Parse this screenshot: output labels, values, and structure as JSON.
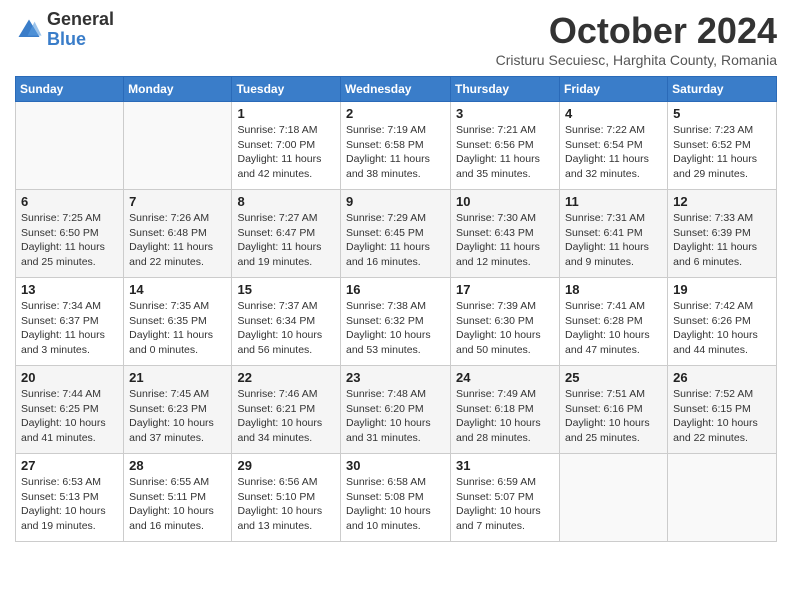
{
  "header": {
    "logo_general": "General",
    "logo_blue": "Blue",
    "month_title": "October 2024",
    "subtitle": "Cristuru Secuiesc, Harghita County, Romania"
  },
  "days_of_week": [
    "Sunday",
    "Monday",
    "Tuesday",
    "Wednesday",
    "Thursday",
    "Friday",
    "Saturday"
  ],
  "weeks": [
    [
      {
        "day": "",
        "info": ""
      },
      {
        "day": "",
        "info": ""
      },
      {
        "day": "1",
        "info": "Sunrise: 7:18 AM\nSunset: 7:00 PM\nDaylight: 11 hours and 42 minutes."
      },
      {
        "day": "2",
        "info": "Sunrise: 7:19 AM\nSunset: 6:58 PM\nDaylight: 11 hours and 38 minutes."
      },
      {
        "day": "3",
        "info": "Sunrise: 7:21 AM\nSunset: 6:56 PM\nDaylight: 11 hours and 35 minutes."
      },
      {
        "day": "4",
        "info": "Sunrise: 7:22 AM\nSunset: 6:54 PM\nDaylight: 11 hours and 32 minutes."
      },
      {
        "day": "5",
        "info": "Sunrise: 7:23 AM\nSunset: 6:52 PM\nDaylight: 11 hours and 29 minutes."
      }
    ],
    [
      {
        "day": "6",
        "info": "Sunrise: 7:25 AM\nSunset: 6:50 PM\nDaylight: 11 hours and 25 minutes."
      },
      {
        "day": "7",
        "info": "Sunrise: 7:26 AM\nSunset: 6:48 PM\nDaylight: 11 hours and 22 minutes."
      },
      {
        "day": "8",
        "info": "Sunrise: 7:27 AM\nSunset: 6:47 PM\nDaylight: 11 hours and 19 minutes."
      },
      {
        "day": "9",
        "info": "Sunrise: 7:29 AM\nSunset: 6:45 PM\nDaylight: 11 hours and 16 minutes."
      },
      {
        "day": "10",
        "info": "Sunrise: 7:30 AM\nSunset: 6:43 PM\nDaylight: 11 hours and 12 minutes."
      },
      {
        "day": "11",
        "info": "Sunrise: 7:31 AM\nSunset: 6:41 PM\nDaylight: 11 hours and 9 minutes."
      },
      {
        "day": "12",
        "info": "Sunrise: 7:33 AM\nSunset: 6:39 PM\nDaylight: 11 hours and 6 minutes."
      }
    ],
    [
      {
        "day": "13",
        "info": "Sunrise: 7:34 AM\nSunset: 6:37 PM\nDaylight: 11 hours and 3 minutes."
      },
      {
        "day": "14",
        "info": "Sunrise: 7:35 AM\nSunset: 6:35 PM\nDaylight: 11 hours and 0 minutes."
      },
      {
        "day": "15",
        "info": "Sunrise: 7:37 AM\nSunset: 6:34 PM\nDaylight: 10 hours and 56 minutes."
      },
      {
        "day": "16",
        "info": "Sunrise: 7:38 AM\nSunset: 6:32 PM\nDaylight: 10 hours and 53 minutes."
      },
      {
        "day": "17",
        "info": "Sunrise: 7:39 AM\nSunset: 6:30 PM\nDaylight: 10 hours and 50 minutes."
      },
      {
        "day": "18",
        "info": "Sunrise: 7:41 AM\nSunset: 6:28 PM\nDaylight: 10 hours and 47 minutes."
      },
      {
        "day": "19",
        "info": "Sunrise: 7:42 AM\nSunset: 6:26 PM\nDaylight: 10 hours and 44 minutes."
      }
    ],
    [
      {
        "day": "20",
        "info": "Sunrise: 7:44 AM\nSunset: 6:25 PM\nDaylight: 10 hours and 41 minutes."
      },
      {
        "day": "21",
        "info": "Sunrise: 7:45 AM\nSunset: 6:23 PM\nDaylight: 10 hours and 37 minutes."
      },
      {
        "day": "22",
        "info": "Sunrise: 7:46 AM\nSunset: 6:21 PM\nDaylight: 10 hours and 34 minutes."
      },
      {
        "day": "23",
        "info": "Sunrise: 7:48 AM\nSunset: 6:20 PM\nDaylight: 10 hours and 31 minutes."
      },
      {
        "day": "24",
        "info": "Sunrise: 7:49 AM\nSunset: 6:18 PM\nDaylight: 10 hours and 28 minutes."
      },
      {
        "day": "25",
        "info": "Sunrise: 7:51 AM\nSunset: 6:16 PM\nDaylight: 10 hours and 25 minutes."
      },
      {
        "day": "26",
        "info": "Sunrise: 7:52 AM\nSunset: 6:15 PM\nDaylight: 10 hours and 22 minutes."
      }
    ],
    [
      {
        "day": "27",
        "info": "Sunrise: 6:53 AM\nSunset: 5:13 PM\nDaylight: 10 hours and 19 minutes."
      },
      {
        "day": "28",
        "info": "Sunrise: 6:55 AM\nSunset: 5:11 PM\nDaylight: 10 hours and 16 minutes."
      },
      {
        "day": "29",
        "info": "Sunrise: 6:56 AM\nSunset: 5:10 PM\nDaylight: 10 hours and 13 minutes."
      },
      {
        "day": "30",
        "info": "Sunrise: 6:58 AM\nSunset: 5:08 PM\nDaylight: 10 hours and 10 minutes."
      },
      {
        "day": "31",
        "info": "Sunrise: 6:59 AM\nSunset: 5:07 PM\nDaylight: 10 hours and 7 minutes."
      },
      {
        "day": "",
        "info": ""
      },
      {
        "day": "",
        "info": ""
      }
    ]
  ]
}
